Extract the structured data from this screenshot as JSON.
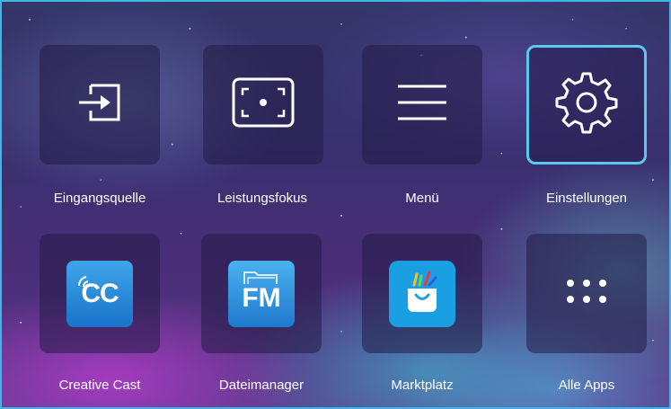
{
  "tiles": [
    {
      "label": "Eingangsquelle",
      "icon": "input-source-icon"
    },
    {
      "label": "Leistungsfokus",
      "icon": "focus-icon"
    },
    {
      "label": "Menü",
      "icon": "menu-icon"
    },
    {
      "label": "Einstellungen",
      "icon": "gear-icon",
      "selected": true
    },
    {
      "label": "Creative Cast",
      "icon": "creative-cast-icon",
      "badge": "CC"
    },
    {
      "label": "Dateimanager",
      "icon": "file-manager-icon",
      "badge": "FM"
    },
    {
      "label": "Marktplatz",
      "icon": "marketplace-icon"
    },
    {
      "label": "Alle Apps",
      "icon": "all-apps-icon"
    }
  ],
  "colors": {
    "selection_border": "#5cc8f0",
    "frame_border": "#3fb6e8",
    "app_icon_blue": "#1b9fe3"
  }
}
